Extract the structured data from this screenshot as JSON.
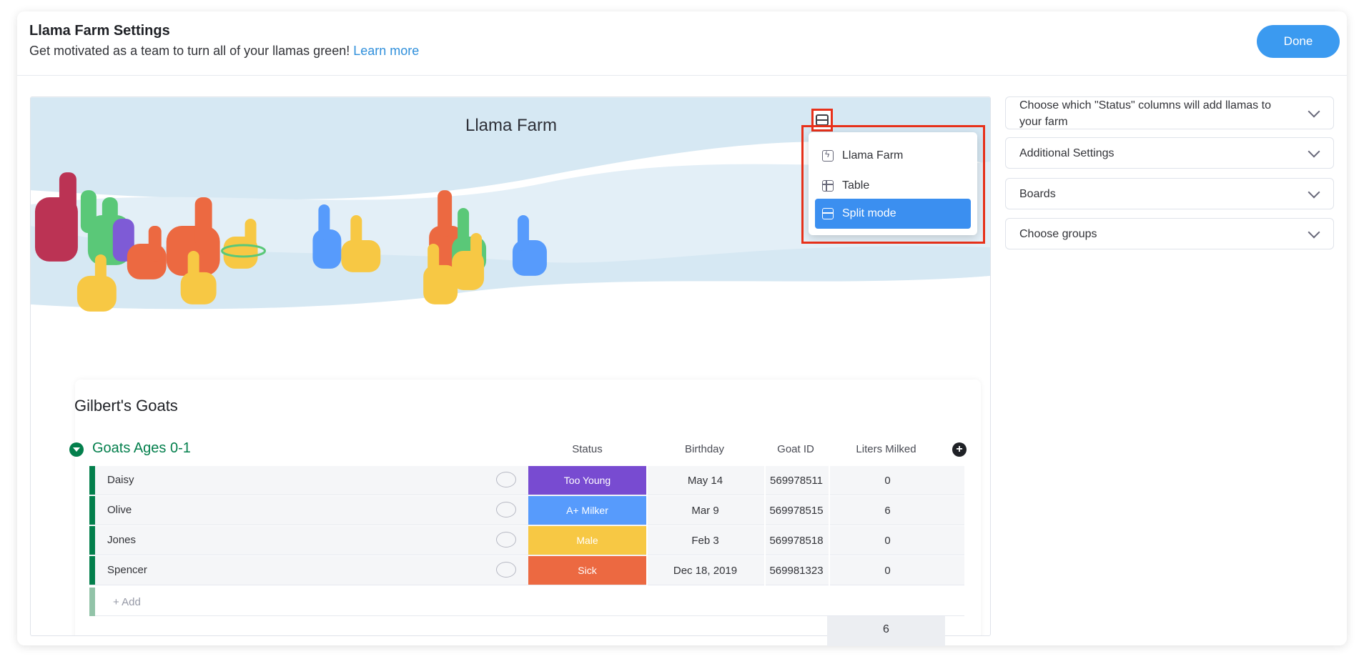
{
  "header": {
    "title": "Llama Farm Settings",
    "subtitle": "Get motivated as a team to turn all of your llamas green!",
    "learn_more": "Learn more",
    "done_label": "Done"
  },
  "preview": {
    "farm_title": "Llama Farm",
    "view_menu": [
      {
        "label": "Llama Farm",
        "icon": "bolt-icon"
      },
      {
        "label": "Table",
        "icon": "table-icon"
      },
      {
        "label": "Split mode",
        "icon": "split-icon",
        "active": true
      }
    ],
    "board": {
      "name": "Gilbert's Goats",
      "group": "Goats Ages 0-1",
      "columns": [
        "Status",
        "Birthday",
        "Goat ID",
        "Liters Milked"
      ],
      "rows": [
        {
          "name": "Daisy",
          "status": "Too Young",
          "status_color": "#784bd1",
          "birthday": "May 14",
          "goat_id": "569978511",
          "liters": "0"
        },
        {
          "name": "Olive",
          "status": "A+ Milker",
          "status_color": "#579bfc",
          "birthday": "Mar 9",
          "goat_id": "569978515",
          "liters": "6"
        },
        {
          "name": "Jones",
          "status": "Male",
          "status_color": "#f7c844",
          "birthday": "Feb 3",
          "goat_id": "569978518",
          "liters": "0"
        },
        {
          "name": "Spencer",
          "status": "Sick",
          "status_color": "#ec6941",
          "birthday": "Dec 18, 2019",
          "goat_id": "569981323",
          "liters": "0"
        }
      ],
      "add_label": "+ Add",
      "liters_sum": "6"
    }
  },
  "settings": [
    {
      "label": "Choose which \"Status\" columns will add llamas to your farm"
    },
    {
      "label": "Additional Settings"
    },
    {
      "label": "Boards"
    },
    {
      "label": "Choose groups"
    }
  ],
  "colors": {
    "accent": "#3b9af0",
    "group_green": "#037f4c",
    "highlight_red": "#e8311a"
  }
}
